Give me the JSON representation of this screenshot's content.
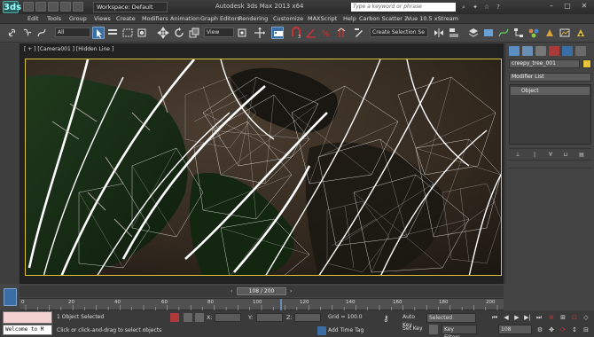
{
  "app": {
    "title": "Autodesk 3ds Max  2013 x64",
    "logo": "3ds",
    "workspace": "Workspace: Default",
    "search_placeholder": "Type a keyword or phrase"
  },
  "menu": [
    "Edit",
    "Tools",
    "Group",
    "Views",
    "Create",
    "Modifiers",
    "Animation",
    "Graph Editors",
    "Rendering",
    "Customize",
    "MAXScript",
    "Help",
    "Carbon Scatter 2",
    "Vue 10.5 xStream"
  ],
  "toolbar": {
    "selection_filter": "All",
    "reference_coord": "View",
    "named_selection": "Create Selection Se"
  },
  "viewport": {
    "label": "[ + ] [Camera001 ] [Hidden Line ]"
  },
  "command_panel": {
    "object_name": "creepy_tree_001",
    "object_color": "#e8c43a",
    "modifier_list": "Modifier List",
    "stack_items": [
      "Object"
    ]
  },
  "timeline": {
    "frame_display": "108 / 200",
    "current_frame": 108,
    "total_frames": 200,
    "ruler_labels": [
      "0",
      "20",
      "40",
      "60",
      "80",
      "100",
      "120",
      "140",
      "160",
      "180",
      "200"
    ]
  },
  "status": {
    "selection": "1 Object Selected",
    "prompt": "Click or click-and-drag to select objects",
    "x_label": "X:",
    "y_label": "Y:",
    "z_label": "Z:",
    "grid": "Grid = 100.0",
    "add_time_tag": "Add Time Tag",
    "auto_key": "Auto Key",
    "set_key": "Set Key",
    "key_mode": "Selected",
    "key_filters": "Key Filters...",
    "frame_field": "108",
    "maxscript": "Welcome to M"
  },
  "colors": {
    "selection_highlight": "#3a6ea5",
    "safe_frame": "#d9c43a"
  }
}
